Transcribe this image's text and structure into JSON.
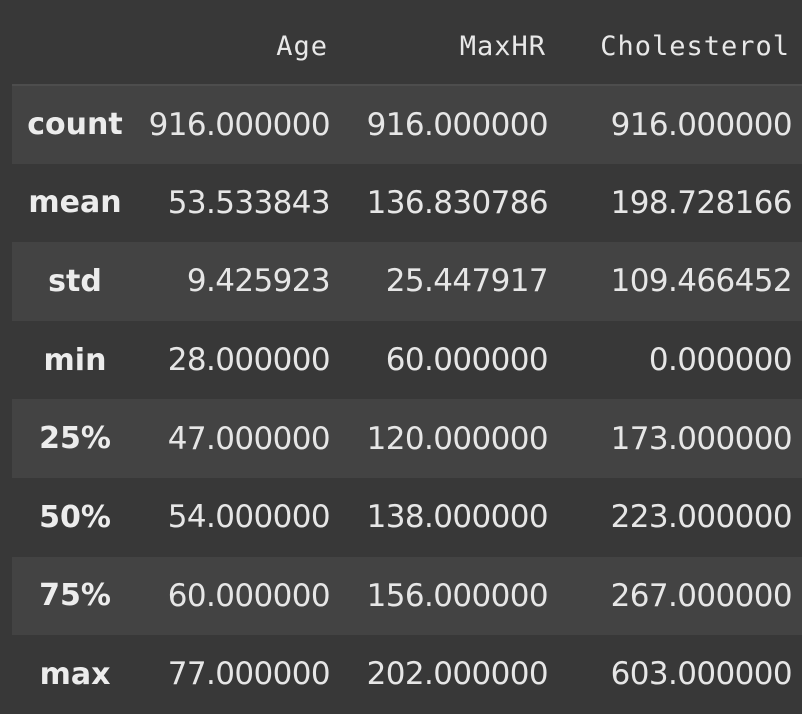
{
  "table": {
    "columns": [
      "Age",
      "MaxHR",
      "Cholesterol"
    ],
    "rows": [
      {
        "label": "count",
        "values": [
          "916.000000",
          "916.000000",
          "916.000000"
        ]
      },
      {
        "label": "mean",
        "values": [
          "53.533843",
          "136.830786",
          "198.728166"
        ]
      },
      {
        "label": "std",
        "values": [
          "9.425923",
          "25.447917",
          "109.466452"
        ]
      },
      {
        "label": "min",
        "values": [
          "28.000000",
          "60.000000",
          "0.000000"
        ]
      },
      {
        "label": "25%",
        "values": [
          "47.000000",
          "120.000000",
          "173.000000"
        ]
      },
      {
        "label": "50%",
        "values": [
          "54.000000",
          "138.000000",
          "223.000000"
        ]
      },
      {
        "label": "75%",
        "values": [
          "60.000000",
          "156.000000",
          "267.000000"
        ]
      },
      {
        "label": "max",
        "values": [
          "77.000000",
          "202.000000",
          "603.000000"
        ]
      }
    ]
  }
}
